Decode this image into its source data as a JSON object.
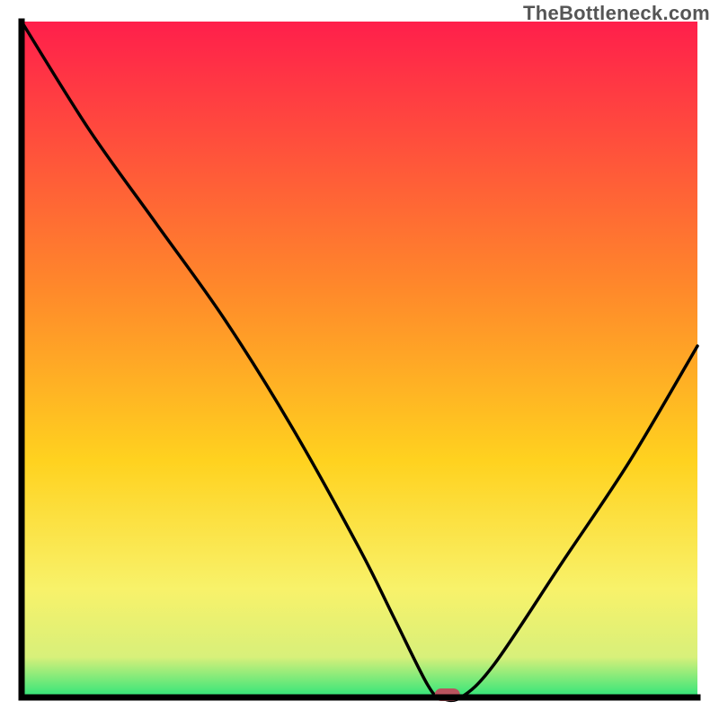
{
  "watermark": "TheBottleneck.com",
  "chart_data": {
    "type": "line",
    "title": "",
    "xlabel": "",
    "ylabel": "",
    "xlim": [
      0,
      100
    ],
    "ylim": [
      0,
      100
    ],
    "x": [
      0,
      10,
      20,
      30,
      40,
      50,
      55,
      60,
      62,
      65,
      70,
      80,
      90,
      100
    ],
    "values": [
      100,
      84,
      70,
      56,
      40,
      22,
      12,
      2,
      0,
      0,
      5,
      20,
      35,
      52
    ],
    "optimal_x": 63,
    "gradient_stops": [
      {
        "offset": 0,
        "color": "#ff1f4b"
      },
      {
        "offset": 40,
        "color": "#ff8a2a"
      },
      {
        "offset": 65,
        "color": "#ffd21f"
      },
      {
        "offset": 84,
        "color": "#f8f26a"
      },
      {
        "offset": 94,
        "color": "#d8f07a"
      },
      {
        "offset": 100,
        "color": "#2ee57a"
      }
    ]
  }
}
